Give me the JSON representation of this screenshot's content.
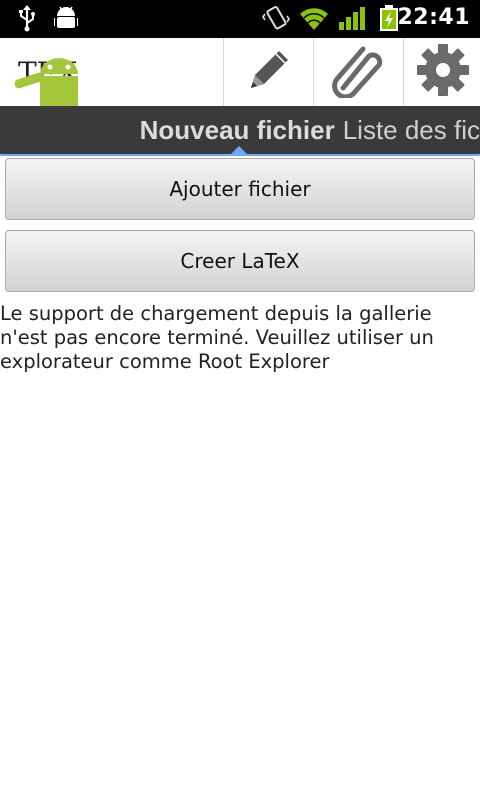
{
  "status_bar": {
    "time": "22:41",
    "icons": [
      "usb-icon",
      "android-debug-icon",
      "vibrate-icon",
      "wifi-icon",
      "signal-icon",
      "battery-charging-icon"
    ],
    "accent_color": "#8bc400"
  },
  "action_bar": {
    "logo_text": "TEX",
    "actions": [
      "pencil-icon",
      "paperclip-icon",
      "gear-icon"
    ]
  },
  "tabs": {
    "active_label": "Nouveau fichier",
    "next_label": "Liste des fic"
  },
  "buttons": {
    "add_file": "Ajouter fichier",
    "create_latex": "Creer LaTeX"
  },
  "message": "Le support de chargement depuis la gallerie n'est pas encore terminé. Veuillez utiliser un explorateur comme Root Explorer",
  "colors": {
    "tab_strip": "#3a3a3a",
    "tab_indicator": "#6fa8ff",
    "android_green": "#a4c639"
  }
}
